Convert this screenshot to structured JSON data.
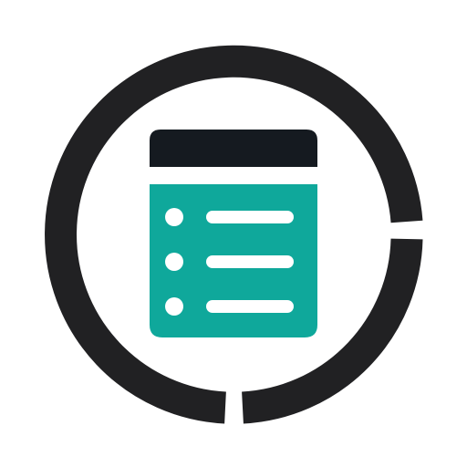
{
  "icon": {
    "name": "list-document-icon",
    "colors": {
      "background": "#ffffff",
      "ring": "#212123",
      "header": "#151a20",
      "body": "#0fa89b",
      "lines": "#ffffff"
    },
    "list_item_count": 3
  }
}
